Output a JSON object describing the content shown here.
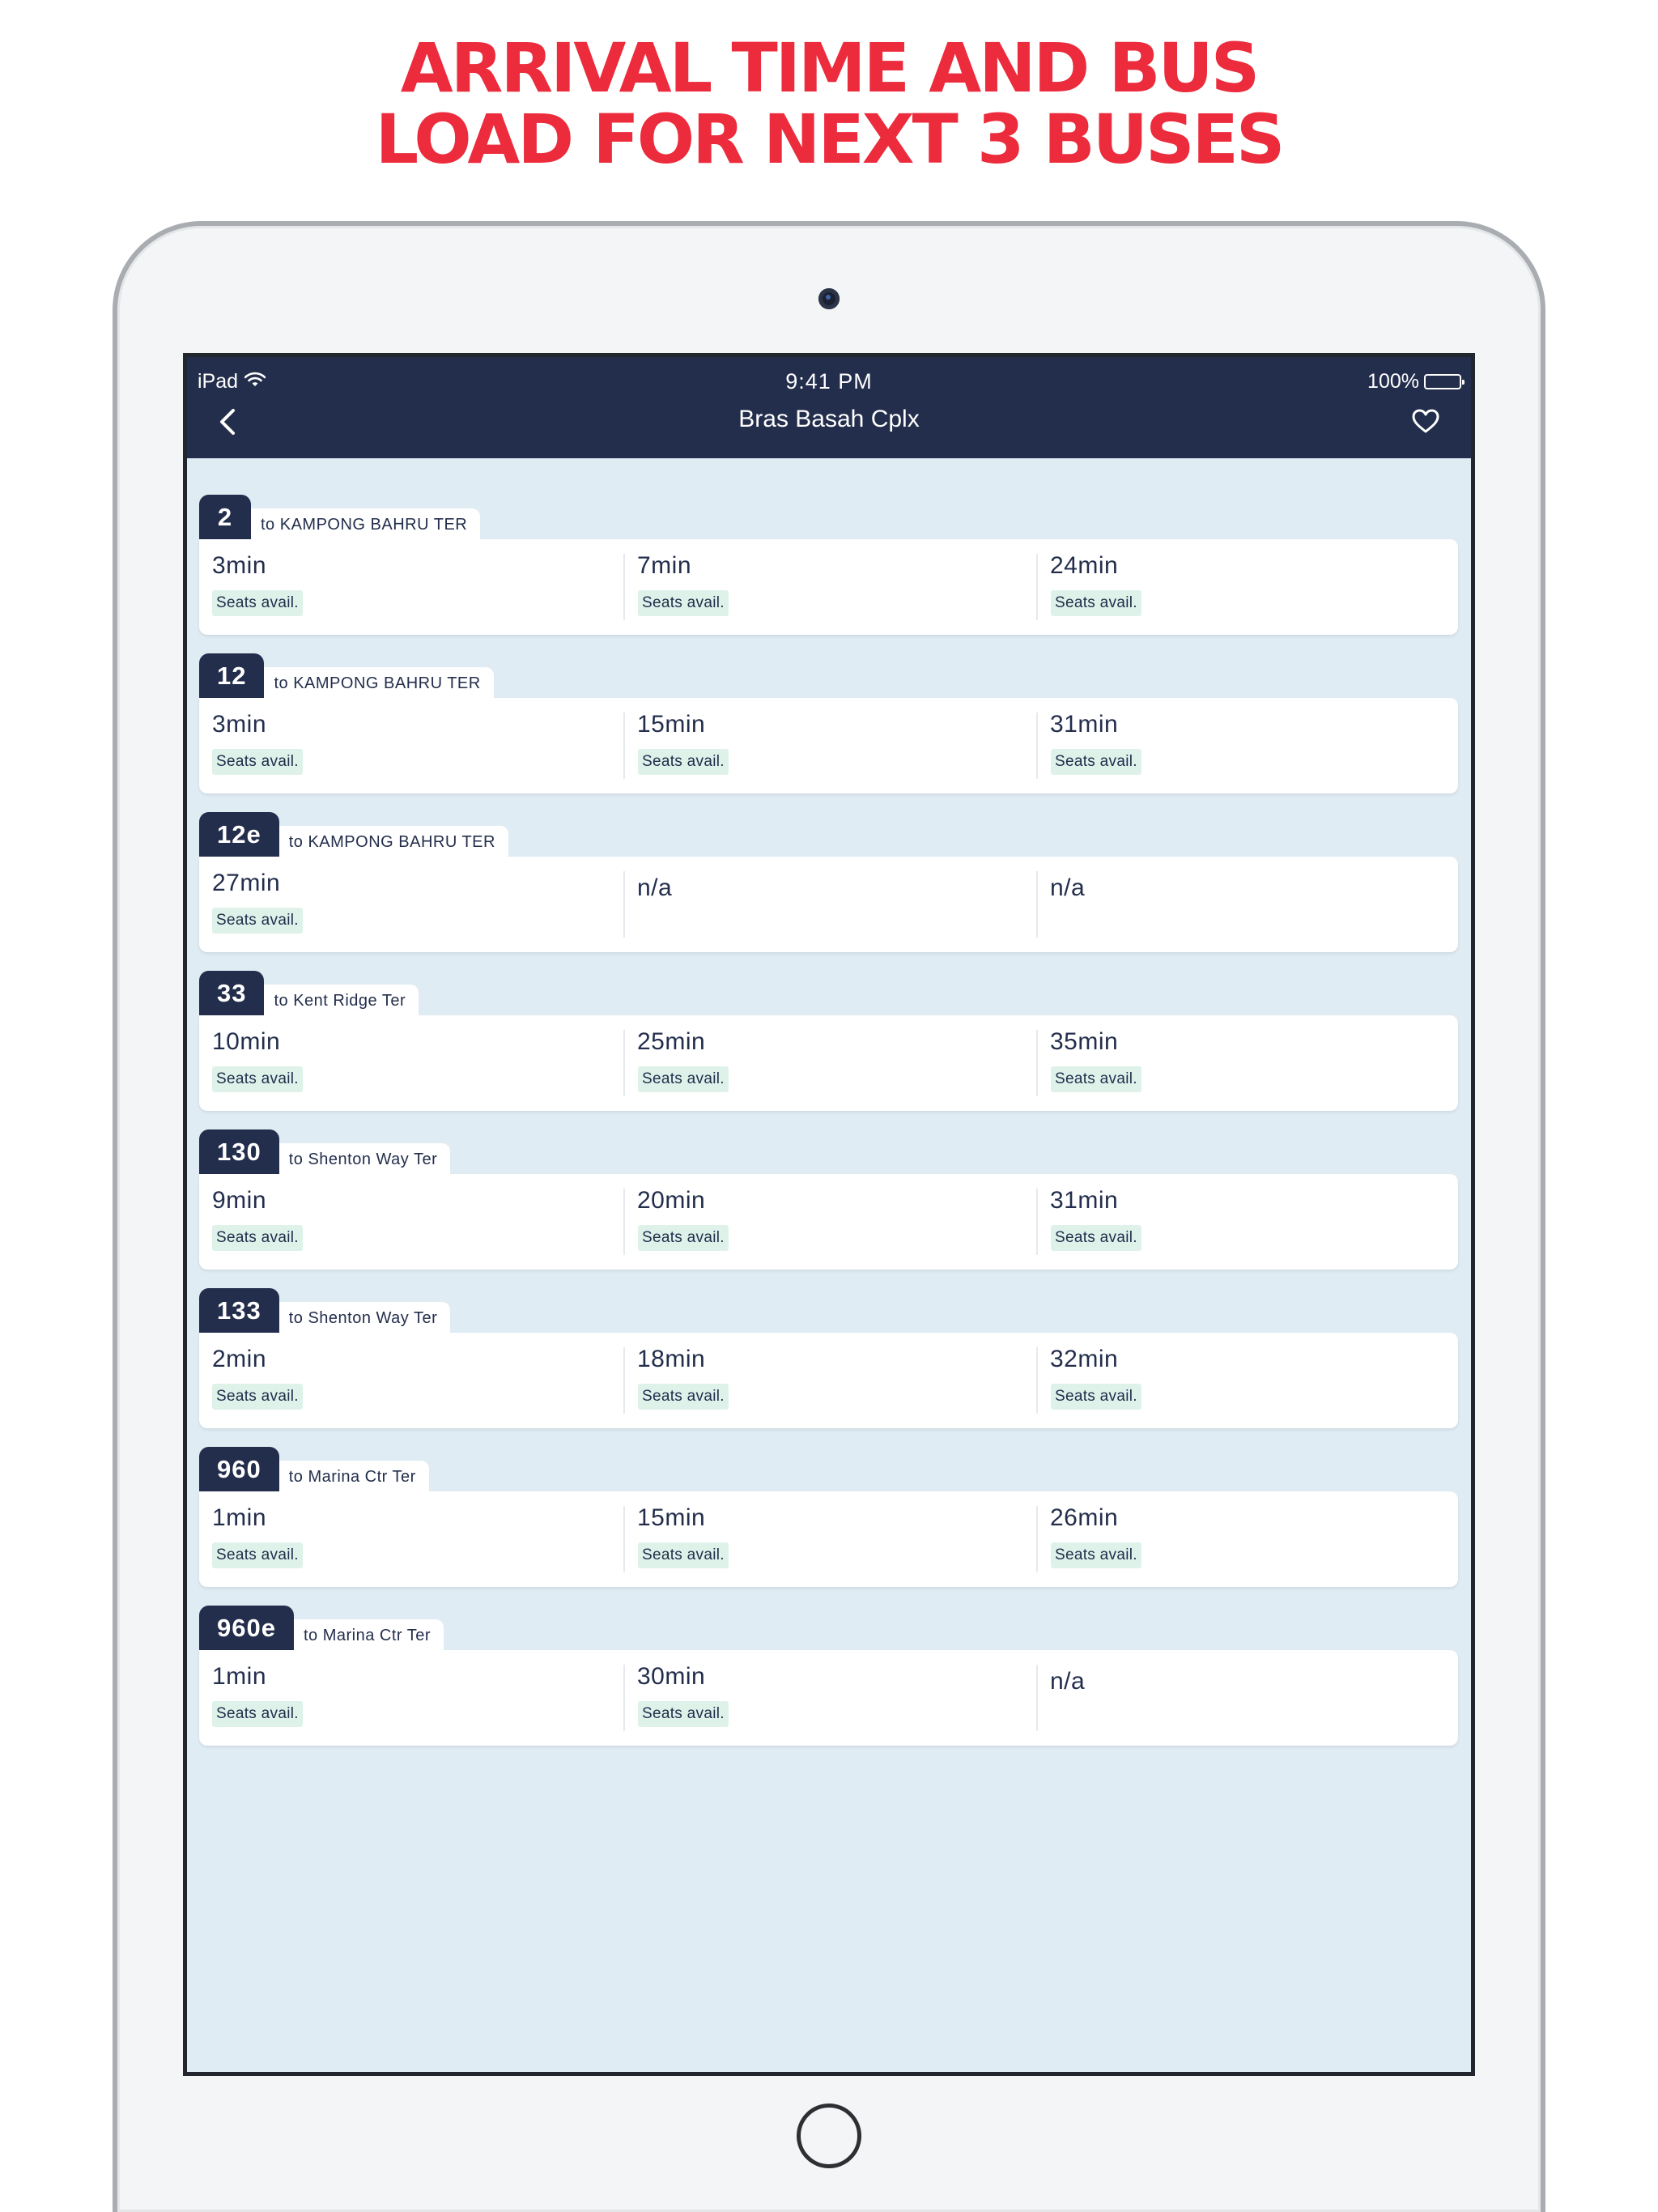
{
  "headline": {
    "line1": "ARRIVAL TIME AND BUS",
    "line2": "LOAD FOR NEXT 3 BUSES"
  },
  "status_bar": {
    "device": "iPad",
    "time": "9:41 PM",
    "battery": "100%"
  },
  "nav": {
    "title": "Bras Basah Cplx",
    "back_icon": "chevron-left-icon",
    "favorite_icon": "heart-outline-icon"
  },
  "colors": {
    "headline": "#ec2b3c",
    "navbar": "#232e4c",
    "background": "#e0ecf3",
    "seat_badge": "#dff2ea"
  },
  "services": [
    {
      "number": "2",
      "destination": "to KAMPONG BAHRU TER",
      "arrivals": [
        {
          "eta": "3min",
          "load": "Seats avail."
        },
        {
          "eta": "7min",
          "load": "Seats avail."
        },
        {
          "eta": "24min",
          "load": "Seats avail."
        }
      ]
    },
    {
      "number": "12",
      "destination": "to KAMPONG BAHRU TER",
      "arrivals": [
        {
          "eta": "3min",
          "load": "Seats avail."
        },
        {
          "eta": "15min",
          "load": "Seats avail."
        },
        {
          "eta": "31min",
          "load": "Seats avail."
        }
      ]
    },
    {
      "number": "12e",
      "destination": "to KAMPONG BAHRU TER",
      "arrivals": [
        {
          "eta": "27min",
          "load": "Seats avail."
        },
        {
          "eta": "n/a",
          "load": ""
        },
        {
          "eta": "n/a",
          "load": ""
        }
      ]
    },
    {
      "number": "33",
      "destination": "to Kent Ridge Ter",
      "arrivals": [
        {
          "eta": "10min",
          "load": "Seats avail."
        },
        {
          "eta": "25min",
          "load": "Seats avail."
        },
        {
          "eta": "35min",
          "load": "Seats avail."
        }
      ]
    },
    {
      "number": "130",
      "destination": "to Shenton Way Ter",
      "arrivals": [
        {
          "eta": "9min",
          "load": "Seats avail."
        },
        {
          "eta": "20min",
          "load": "Seats avail."
        },
        {
          "eta": "31min",
          "load": "Seats avail."
        }
      ]
    },
    {
      "number": "133",
      "destination": "to Shenton Way Ter",
      "arrivals": [
        {
          "eta": "2min",
          "load": "Seats avail."
        },
        {
          "eta": "18min",
          "load": "Seats avail."
        },
        {
          "eta": "32min",
          "load": "Seats avail."
        }
      ]
    },
    {
      "number": "960",
      "destination": "to Marina Ctr Ter",
      "arrivals": [
        {
          "eta": "1min",
          "load": "Seats avail."
        },
        {
          "eta": "15min",
          "load": "Seats avail."
        },
        {
          "eta": "26min",
          "load": "Seats avail."
        }
      ]
    },
    {
      "number": "960e",
      "destination": "to Marina Ctr Ter",
      "arrivals": [
        {
          "eta": "1min",
          "load": "Seats avail."
        },
        {
          "eta": "30min",
          "load": "Seats avail."
        },
        {
          "eta": "n/a",
          "load": ""
        }
      ]
    }
  ]
}
